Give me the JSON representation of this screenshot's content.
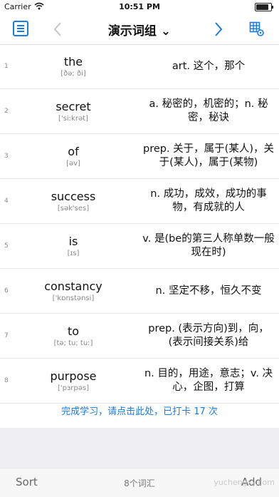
{
  "status_bar": {
    "carrier": "Carrier",
    "time": "10:51 PM"
  },
  "nav": {
    "title": "演示词组 ⌄"
  },
  "words": [
    {
      "index": "1",
      "word": "the",
      "ipa": "[ðə; ði]",
      "meaning": "art. 这个，那个"
    },
    {
      "index": "2",
      "word": "secret",
      "ipa": "['siːkrət]",
      "meaning": "a. 秘密的，机密的；n. 秘密，秘诀"
    },
    {
      "index": "3",
      "word": "of",
      "ipa": "[əv]",
      "meaning": "prep. 关于，属于(某人)，关于(某人)，属于(某物)"
    },
    {
      "index": "4",
      "word": "success",
      "ipa": "[sək'ses]",
      "meaning": "n. 成功，成效，成功的事物，有成就的人"
    },
    {
      "index": "5",
      "word": "is",
      "ipa": "[ɪs]",
      "meaning": "v. 是(be的第三人称单数一般现在时)"
    },
    {
      "index": "6",
      "word": "constancy",
      "ipa": "['kɒnstənsi]",
      "meaning": "n. 坚定不移，恒久不变"
    },
    {
      "index": "7",
      "word": "to",
      "ipa": "[tə; tu; tuː]",
      "meaning": "prep. (表示方向)到，向，(表示间接关系)给"
    },
    {
      "index": "8",
      "word": "purpose",
      "ipa": "['pɜrpəs]",
      "meaning": "n. 目的，用途，意志；v. 决心，企图，打算"
    }
  ],
  "done_link": "完成学习，请点击此处，已打卡 17 次",
  "bottom_bar": {
    "sort_label": "Sort",
    "count_label": "8个词汇",
    "add_label": "Add"
  },
  "watermark": "yuchengxy.com",
  "colors": {
    "accent": "#1a7be6"
  }
}
